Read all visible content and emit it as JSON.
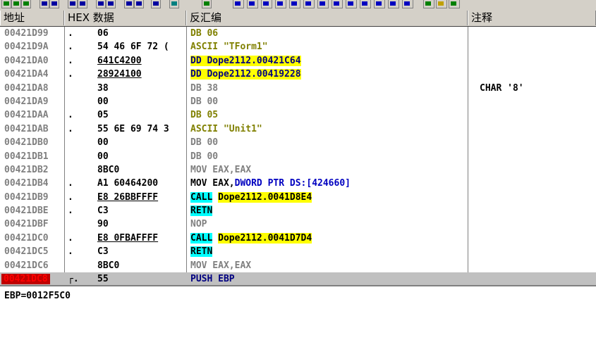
{
  "toolbar": {
    "buttons": [
      "L",
      "E",
      "M",
      "T",
      "W",
      "H",
      "C",
      "/",
      "K",
      "B",
      "R",
      "...",
      "S"
    ]
  },
  "header": {
    "addr": "地址",
    "hex": "HEX 数据",
    "dis": "反汇编",
    "comment": "注释"
  },
  "rows": [
    {
      "addr": "00421D99",
      "mark": ".",
      "hex": "06",
      "dis": "DB 06",
      "com": ""
    },
    {
      "addr": "00421D9A",
      "mark": ".",
      "hex": "54 46 6F 72 (",
      "dis": "ASCII \"TForm1\"",
      "com": ""
    },
    {
      "addr": "00421DA0",
      "mark": ".",
      "hex": "641C4200",
      "dis": "DD Dope2112.00421C64",
      "com": ""
    },
    {
      "addr": "00421DA4",
      "mark": ".",
      "hex": "28924100",
      "dis": "DD Dope2112.00419228",
      "com": ""
    },
    {
      "addr": "00421DA8",
      "mark": "",
      "hex": "38",
      "dis": "DB 38",
      "com": "CHAR '8'"
    },
    {
      "addr": "00421DA9",
      "mark": "",
      "hex": "00",
      "dis": "DB 00",
      "com": ""
    },
    {
      "addr": "00421DAA",
      "mark": ".",
      "hex": "05",
      "dis": "DB 05",
      "com": ""
    },
    {
      "addr": "00421DAB",
      "mark": ".",
      "hex": "55 6E 69 74 3",
      "dis": "ASCII \"Unit1\"",
      "com": ""
    },
    {
      "addr": "00421DB0",
      "mark": "",
      "hex": "00",
      "dis": "DB 00",
      "com": ""
    },
    {
      "addr": "00421DB1",
      "mark": "",
      "hex": "00",
      "dis": "DB 00",
      "com": ""
    },
    {
      "addr": "00421DB2",
      "mark": "",
      "hex": "8BC0",
      "dis": "MOV EAX,EAX",
      "com": ""
    },
    {
      "addr": "00421DB4",
      "mark": ".",
      "hex": "A1 60464200",
      "dis_a": "MOV EAX,",
      "dis_b": "DWORD PTR DS:[424660]",
      "com": ""
    },
    {
      "addr": "00421DB9",
      "mark": ".",
      "hex": "E8 26BBFFFF",
      "dis_a": "CALL",
      "dis_b": "Dope2112.0041D8E4",
      "com": ""
    },
    {
      "addr": "00421DBE",
      "mark": ".",
      "hex": "C3",
      "dis": "RETN",
      "com": ""
    },
    {
      "addr": "00421DBF",
      "mark": "",
      "hex": "90",
      "dis": "NOP",
      "com": ""
    },
    {
      "addr": "00421DC0",
      "mark": ".",
      "hex": "E8 0FBAFFFF",
      "dis_a": "CALL",
      "dis_b": "Dope2112.0041D7D4",
      "com": ""
    },
    {
      "addr": "00421DC5",
      "mark": ".",
      "hex": "C3",
      "dis": "RETN",
      "com": ""
    },
    {
      "addr": "00421DC6",
      "mark": "",
      "hex": "8BC0",
      "dis": "MOV EAX,EAX",
      "com": ""
    },
    {
      "addr": "00421DC8",
      "mark": "┌.",
      "hex": "55",
      "dis": "PUSH EBP",
      "com": ""
    }
  ],
  "status": "EBP=0012F5C0"
}
